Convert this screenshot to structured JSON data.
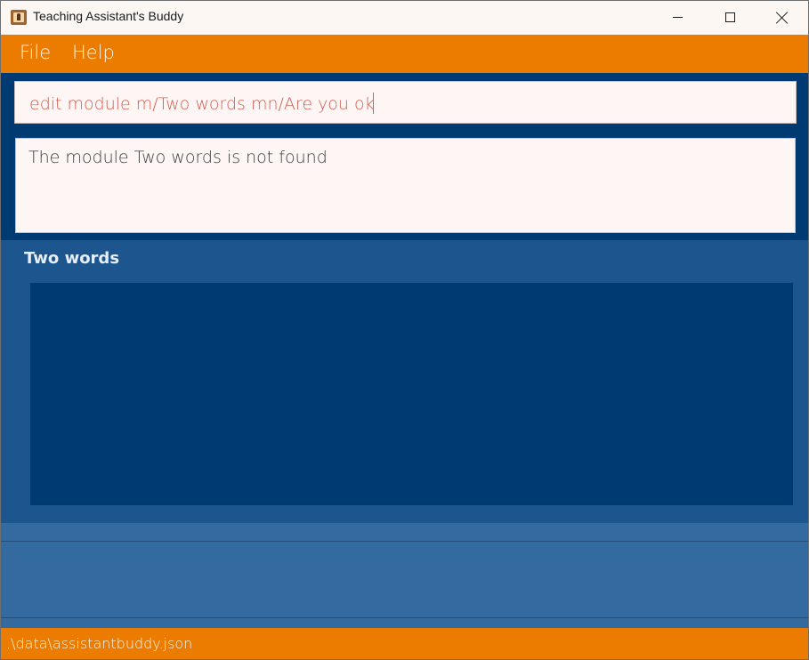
{
  "window": {
    "title": "Teaching Assistant's Buddy",
    "icon": "app-icon",
    "controls": [
      "minimize",
      "maximize",
      "close"
    ]
  },
  "menu": {
    "file_label": "File",
    "help_label": "Help"
  },
  "command": {
    "value": "edit module m/Two words mn/Are you ok"
  },
  "result": {
    "message": "The module Two words is not found"
  },
  "module_panel": {
    "title": "Two words",
    "items": []
  },
  "status": {
    "file_path": ".\\data\\assistantbuddy.json"
  },
  "colors": {
    "accent": "#ec7c00",
    "primary_dark": "#003a73",
    "panel": "#1d568f",
    "panel_light": "#336a9f",
    "command_text": "#d45e52",
    "surface": "#fdf6f4"
  }
}
